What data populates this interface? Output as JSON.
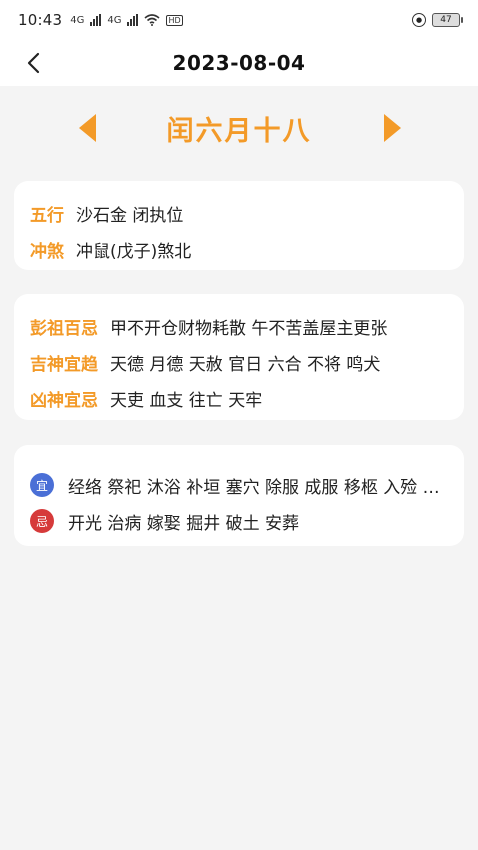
{
  "status_bar": {
    "time": "10:43",
    "signal_1": "4G",
    "signal_2": "4G",
    "hd": "HD",
    "battery": "47"
  },
  "header": {
    "title": "2023-08-04"
  },
  "lunar": {
    "date": "闰六月十八"
  },
  "card1": {
    "wuxing_label": "五行",
    "wuxing_value": "沙石金 闭执位",
    "chongsha_label": "冲煞",
    "chongsha_value": "冲鼠(戊子)煞北"
  },
  "card2": {
    "pengzu_label": "彭祖百忌",
    "pengzu_value": "甲不开仓财物耗散 午不苦盖屋主更张",
    "jishen_label": "吉神宜趋",
    "jishen_value": "天德 月德 天赦 官日 六合 不将 鸣犬",
    "xiongshen_label": "凶神宜忌",
    "xiongshen_value": "天吏 血支 往亡 天牢"
  },
  "card3": {
    "yi_badge": "宜",
    "yi_value": "经络 祭祀 沐浴 补垣 塞穴 除服 成服 移柩 入殓 破土 启攒 安葬",
    "ji_badge": "忌",
    "ji_value": "开光 治病 嫁娶 掘井 破土 安葬"
  },
  "colors": {
    "accent": "#f39a28",
    "yi_badge": "#4a6fd6",
    "ji_badge": "#d63a3a"
  }
}
